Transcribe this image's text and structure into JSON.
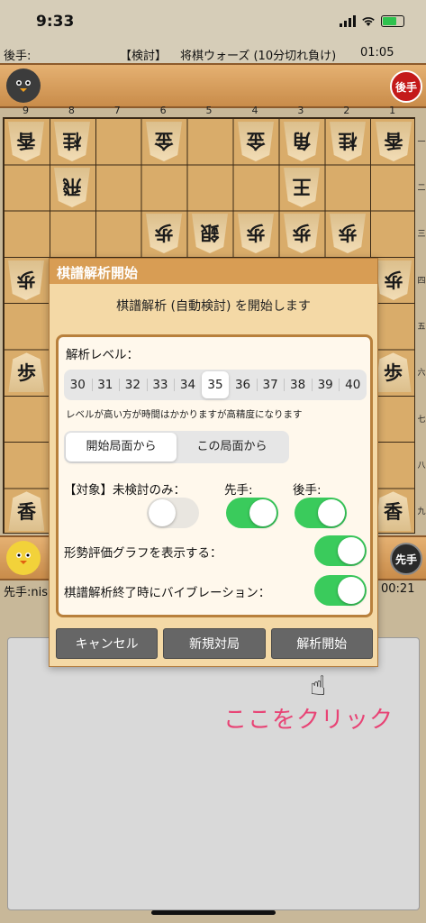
{
  "status_bar": {
    "time": "9:33"
  },
  "info_line": {
    "gote_label": "後手:",
    "mode": "【検討】",
    "game_type": "将棋ウォーズ (10分切れ負け)",
    "clock": "01:05"
  },
  "gote_stand": {
    "badge": "後手"
  },
  "sente_stand": {
    "badge": "先手"
  },
  "sente_line": {
    "label": "先手:nis",
    "clock": "00:21"
  },
  "board": {
    "files": [
      "9",
      "8",
      "7",
      "6",
      "5",
      "4",
      "3",
      "2",
      "1"
    ],
    "ranks": [
      "一",
      "二",
      "三",
      "四",
      "五",
      "六",
      "七",
      "八",
      "九"
    ],
    "pieces": [
      {
        "file": 9,
        "rank": 1,
        "char": "香",
        "side": "gote"
      },
      {
        "file": 8,
        "rank": 1,
        "char": "桂",
        "side": "gote"
      },
      {
        "file": 6,
        "rank": 1,
        "char": "金",
        "side": "gote"
      },
      {
        "file": 4,
        "rank": 1,
        "char": "金",
        "side": "gote"
      },
      {
        "file": 3,
        "rank": 1,
        "char": "角",
        "side": "gote"
      },
      {
        "file": 2,
        "rank": 1,
        "char": "桂",
        "side": "gote"
      },
      {
        "file": 1,
        "rank": 1,
        "char": "香",
        "side": "gote"
      },
      {
        "file": 8,
        "rank": 2,
        "char": "飛",
        "side": "gote"
      },
      {
        "file": 3,
        "rank": 2,
        "char": "王",
        "side": "gote"
      },
      {
        "file": 6,
        "rank": 3,
        "char": "歩",
        "side": "gote"
      },
      {
        "file": 5,
        "rank": 3,
        "char": "銀",
        "side": "gote"
      },
      {
        "file": 4,
        "rank": 3,
        "char": "歩",
        "side": "gote"
      },
      {
        "file": 3,
        "rank": 3,
        "char": "歩",
        "side": "gote"
      },
      {
        "file": 2,
        "rank": 3,
        "char": "歩",
        "side": "gote"
      },
      {
        "file": 9,
        "rank": 4,
        "char": "歩",
        "side": "gote"
      },
      {
        "file": 1,
        "rank": 4,
        "char": "歩",
        "side": "gote"
      },
      {
        "file": 9,
        "rank": 6,
        "char": "歩",
        "side": "sente"
      },
      {
        "file": 1,
        "rank": 6,
        "char": "歩",
        "side": "sente"
      },
      {
        "file": 9,
        "rank": 9,
        "char": "香",
        "side": "sente"
      },
      {
        "file": 1,
        "rank": 9,
        "char": "香",
        "side": "sente"
      }
    ]
  },
  "dialog": {
    "title": "棋譜解析開始",
    "message": "棋譜解析 (自動検討) を開始します",
    "level_label": "解析レベル：",
    "levels": [
      "30",
      "31",
      "32",
      "33",
      "34",
      "35",
      "36",
      "37",
      "38",
      "39",
      "40"
    ],
    "selected_level": "35",
    "level_note": "レベルが高い方が時間はかかりますが高精度になります",
    "start_options": [
      "開始局面から",
      "この局面から"
    ],
    "selected_start": "開始局面から",
    "target_label": "【対象】未検討のみ：",
    "sente_label": "先手:",
    "gote_label": "後手:",
    "graph_label": "形勢評価グラフを表示する：",
    "vibe_label": "棋譜解析終了時にバイブレーション：",
    "toggles": {
      "unreviewed_only": false,
      "sente": true,
      "gote": true,
      "graph": true,
      "vibration": true
    },
    "buttons": {
      "cancel": "キャンセル",
      "new_game": "新規対局",
      "start": "解析開始"
    }
  },
  "annotation": {
    "pointer_icon": "☝",
    "text": "ここをクリック",
    "color": "#e84375"
  }
}
